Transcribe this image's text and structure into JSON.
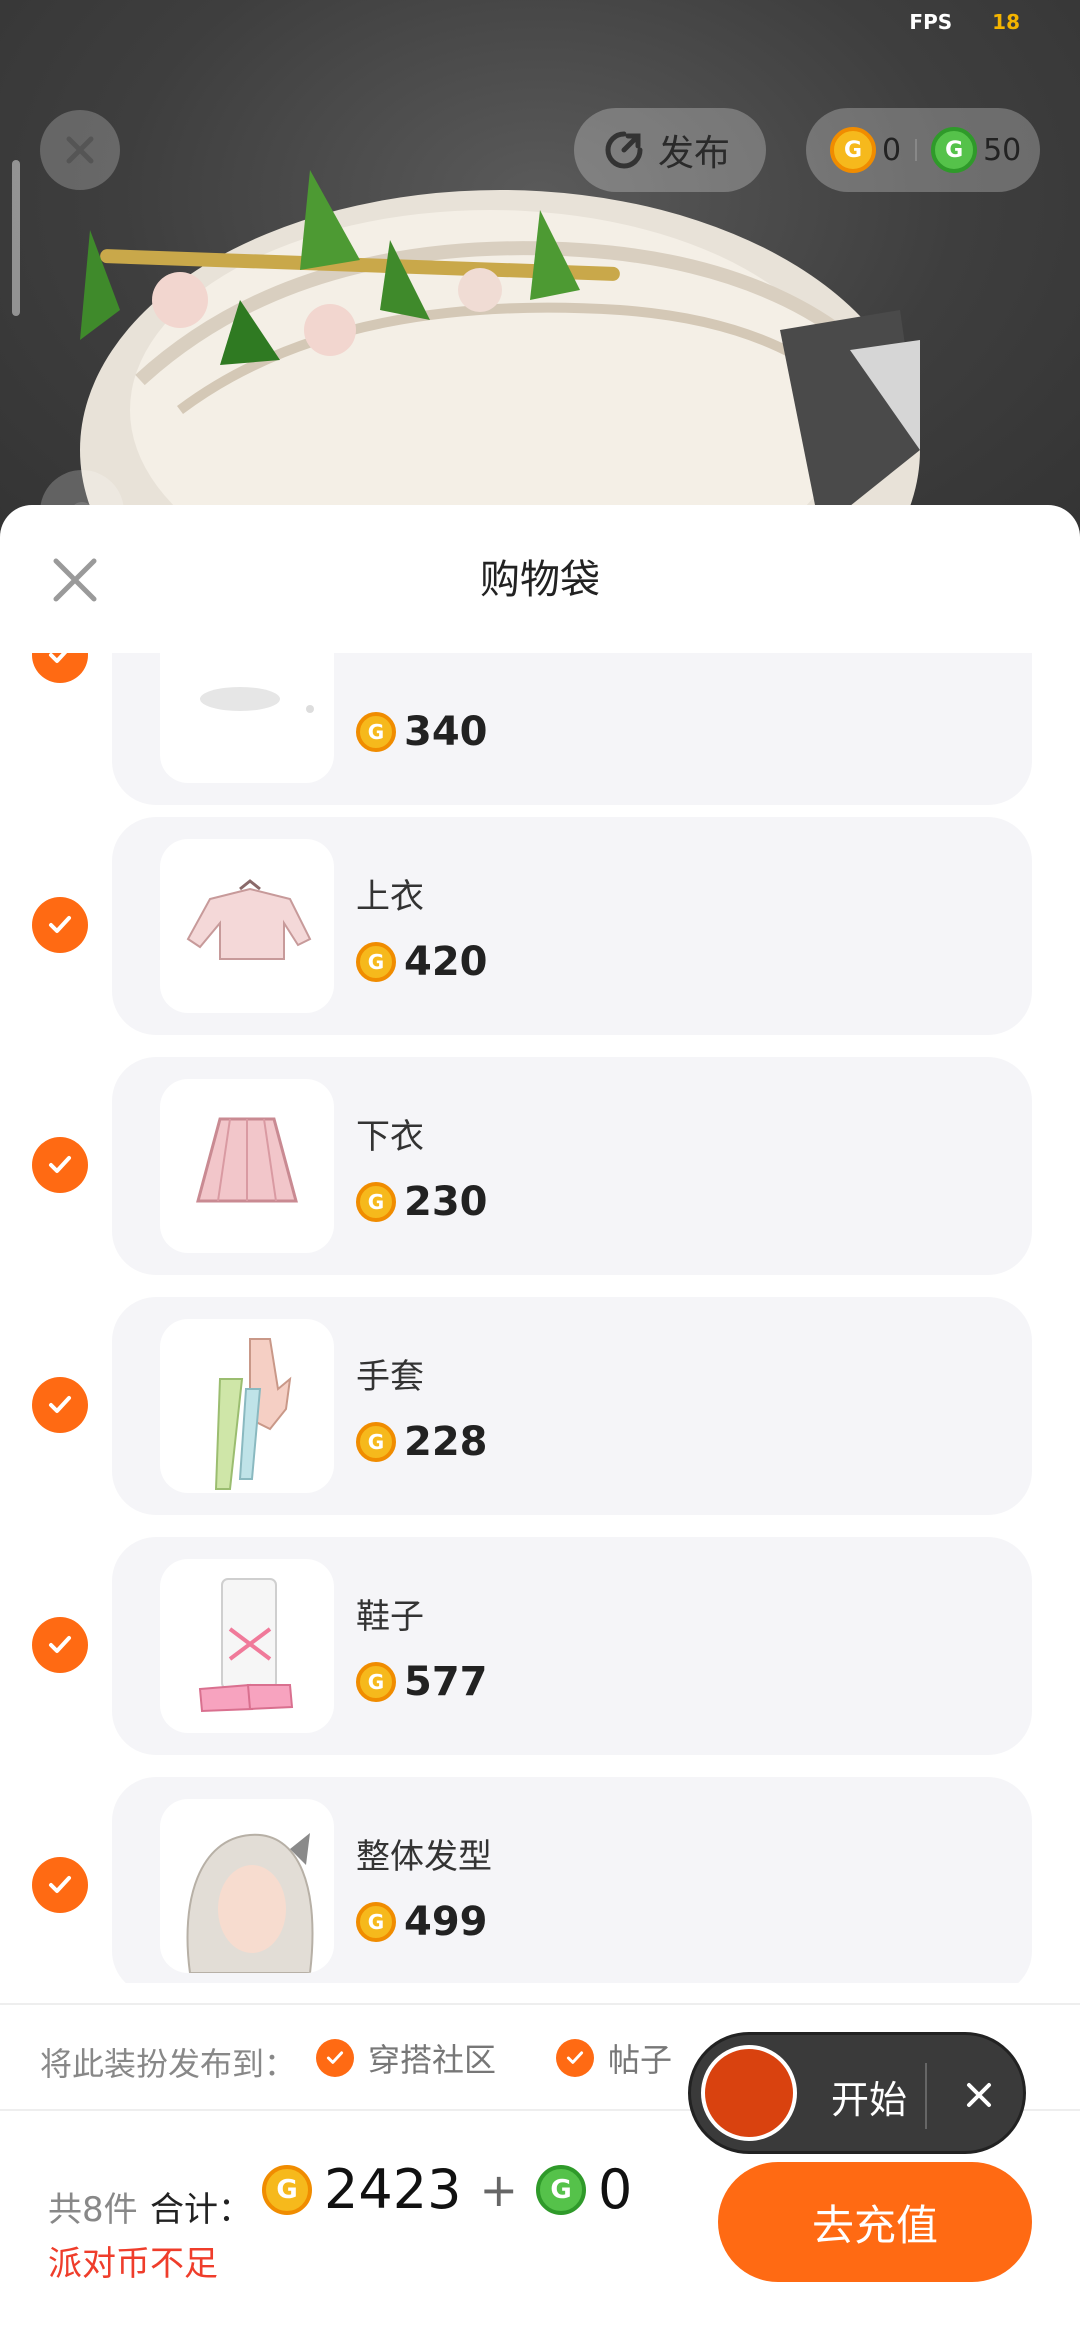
{
  "status": {
    "fps_label": "FPS",
    "fps_value": "18"
  },
  "topbar": {
    "publish_label": "发布",
    "gold_coins": "0",
    "green_coins": "50"
  },
  "sheet": {
    "title": "购物袋",
    "items": [
      {
        "name": "",
        "price": "340",
        "checked": true
      },
      {
        "name": "上衣",
        "price": "420",
        "checked": true
      },
      {
        "name": "下衣",
        "price": "230",
        "checked": true
      },
      {
        "name": "手套",
        "price": "228",
        "checked": true
      },
      {
        "name": "鞋子",
        "price": "577",
        "checked": true
      },
      {
        "name": "整体发型",
        "price": "499",
        "checked": true
      }
    ]
  },
  "publish": {
    "label": "将此装扮发布到：",
    "options": [
      {
        "label": "穿搭社区",
        "checked": true
      },
      {
        "label": "帖子",
        "checked": true
      }
    ]
  },
  "recorder": {
    "start_label": "开始"
  },
  "footer": {
    "count": "共8件",
    "total_label": "合计：",
    "gold_total": "2423",
    "plus": "+",
    "green_total": "0",
    "warning": "派对币不足",
    "recharge_label": "去充值"
  },
  "colors": {
    "accent": "#ff6a13",
    "warning": "#ef3d2b",
    "gold_coin": "#f6b91c",
    "green_coin": "#55c24a"
  },
  "icons": {
    "coin_glyph": "G"
  }
}
